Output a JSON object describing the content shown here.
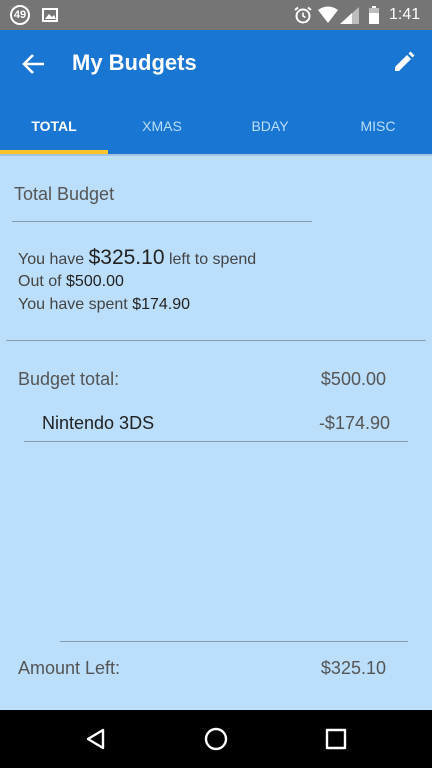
{
  "status_bar": {
    "notification_count": "49",
    "time": "1:41",
    "icons": [
      "gallery-icon",
      "alarm-icon",
      "wifi-icon",
      "signal-icon",
      "battery-icon"
    ]
  },
  "app_bar": {
    "title": "My Budgets",
    "back_icon": "arrow-back-icon",
    "edit_icon": "pencil-icon"
  },
  "tabs": [
    {
      "label": "TOTAL",
      "active": true
    },
    {
      "label": "XMAS",
      "active": false
    },
    {
      "label": "BDAY",
      "active": false
    },
    {
      "label": "MISC",
      "active": false
    }
  ],
  "summary": {
    "title": "Total Budget",
    "left_prefix": "You have",
    "left_amount": "$325.10",
    "left_suffix": "left to spend",
    "out_of_prefix": "Out of",
    "out_of_amount": "$500.00",
    "spent_prefix": "You have spent",
    "spent_amount": "$174.90"
  },
  "budget": {
    "total_label": "Budget total:",
    "total_value": "$500.00",
    "items": [
      {
        "name": "Nintendo 3DS",
        "amount": "-$174.90"
      }
    ],
    "amount_left_label": "Amount Left:",
    "amount_left_value": "$325.10"
  },
  "colors": {
    "app_bar": "#1976d2",
    "tab_indicator": "#f9c32b",
    "background": "#bbdefb",
    "status_bar": "#757575"
  },
  "nav_bar": {
    "icons": [
      "back-triangle-icon",
      "home-circle-icon",
      "recents-square-icon"
    ]
  }
}
